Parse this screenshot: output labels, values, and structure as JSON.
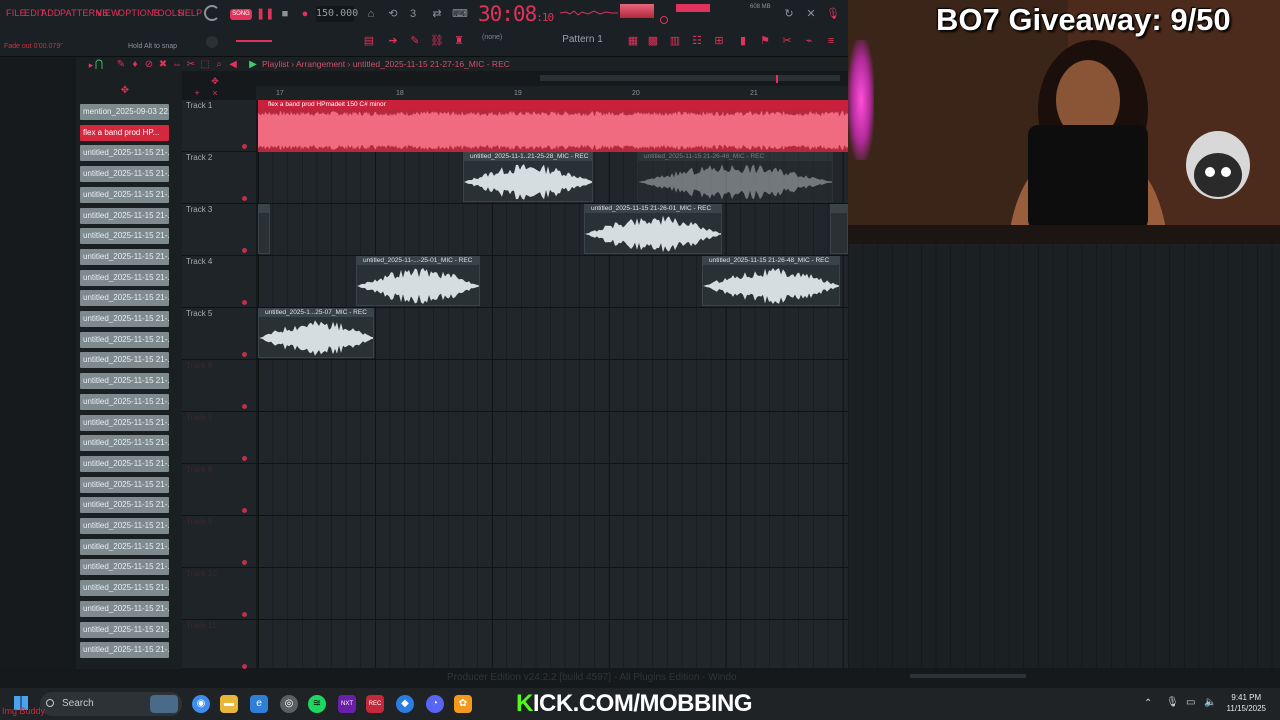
{
  "menu": [
    "FILE",
    "EDIT",
    "ADD",
    "PATTERNS",
    "VIEW",
    "OPTIONS",
    "TOOLS",
    "HELP"
  ],
  "transport": {
    "mode": "SONG",
    "tempo": "150.000",
    "time_main": "30:08",
    "time_sub": "10",
    "memory": "608 MB"
  },
  "hints": {
    "fade": "Fade out  0'00.079\"",
    "snap": "Hold Alt to snap"
  },
  "toolbar": {
    "pattern": "Pattern 1",
    "none": "(none)"
  },
  "playlist": {
    "title": "Playlist › Arrangement › untitled_2025-11-15 21-27-16_MIC - REC"
  },
  "ruler": [
    "17",
    "18",
    "19",
    "20",
    "21"
  ],
  "browser_clips": [
    "mention_2025-09-03 22...",
    "flex a band prod HP...",
    "untitled_2025-11-15 21-...",
    "untitled_2025-11-15 21-...",
    "untitled_2025-11-15 21-...",
    "untitled_2025-11-15 21-...",
    "untitled_2025-11-15 21-...",
    "untitled_2025-11-15 21-...",
    "untitled_2025-11-15 21-...",
    "untitled_2025-11-15 21-...",
    "untitled_2025-11-15 21-...",
    "untitled_2025-11-15 21-...",
    "untitled_2025-11-15 21-...",
    "untitled_2025-11-15 21-...",
    "untitled_2025-11-15 21-...",
    "untitled_2025-11-15 21-...",
    "untitled_2025-11-15 21-...",
    "untitled_2025-11-15 21-...",
    "untitled_2025-11-15 21-...",
    "untitled_2025-11-15 21-...",
    "untitled_2025-11-15 21-...",
    "untitled_2025-11-15 21-...",
    "untitled_2025-11-15 21-...",
    "untitled_2025-11-15 21-...",
    "untitled_2025-11-15 21-...",
    "untitled_2025-11-15 21-...",
    "untitled_2025-11-15 21-..."
  ],
  "tracks": [
    "Track 1",
    "Track 2",
    "Track 3",
    "Track 4",
    "Track 5",
    "Track 6",
    "Track 7",
    "Track 8",
    "Track 9",
    "Track 10",
    "Track 11"
  ],
  "clips": {
    "beat": "flex a band prod HPmadeit 150 C# minor",
    "t2a": "untitled_2025-11-1..21-25-28_MIC - REC",
    "t2b": "untitled_2025-11-15 21-26-48_MIC - REC",
    "t3a": "untitled_2025-11-15 21-26-01_MIC - REC",
    "t4a": "untitled_2025-11-...-25-01_MIC - REC",
    "t4b": "untitled_2025-11-15 21-26-48_MIC - REC",
    "t5a": "untitled_2025-1...25-07_MIC - REC"
  },
  "status_bar": "Producer Edition v24.2.2 [build 4597] - All Plugins Edition - Windo",
  "overlay": {
    "giveaway": "BO7 Giveaway: 9/50",
    "kick_k": "K",
    "kick_rest": "ICK.COM/MOBBING"
  },
  "taskbar": {
    "search": "Search",
    "time": "9:41 PM",
    "date": "11/15/2025"
  },
  "corner": "Img Buddy",
  "colors": {
    "accent": "#e0325a",
    "beat_clip": "#b8283c",
    "kick_green": "#53fc18"
  }
}
